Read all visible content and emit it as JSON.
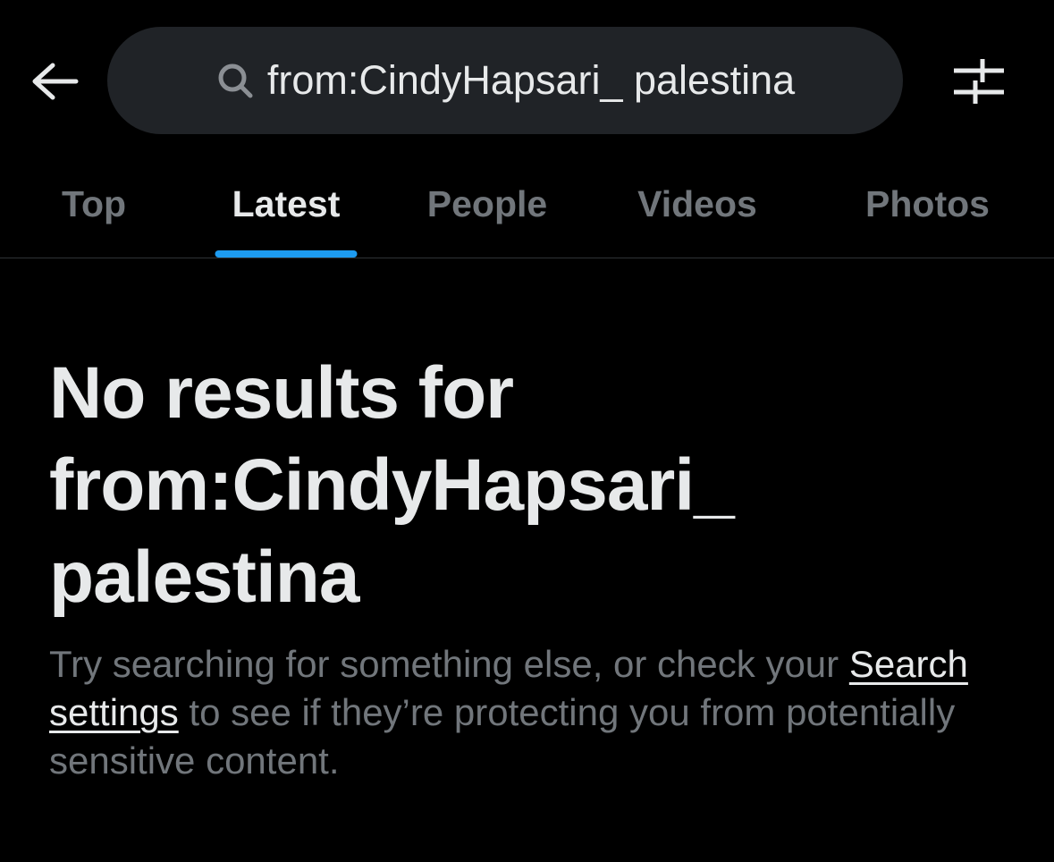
{
  "header": {
    "back_icon": "arrow-left-icon",
    "search": {
      "icon": "search-icon",
      "query": "from:CindyHapsari_ palestina"
    },
    "filter_icon": "filter-sliders-icon"
  },
  "tabs": [
    {
      "label": "Top",
      "active": false
    },
    {
      "label": "Latest",
      "active": true
    },
    {
      "label": "People",
      "active": false
    },
    {
      "label": "Videos",
      "active": false
    },
    {
      "label": "Photos",
      "active": false
    }
  ],
  "empty_state": {
    "title_line1": "No results for",
    "title_line2": "from:CindyHapsari_",
    "title_line3": "palestina",
    "body_before": "Try searching for something else, or check your ",
    "link_label": "Search settings",
    "body_after": " to see if they’re protecting you from potentially sensitive content."
  },
  "colors": {
    "background": "#000000",
    "primary_text": "#e7e9ea",
    "secondary_text": "#71767b",
    "accent": "#1d9bf0",
    "search_bg": "#202327"
  }
}
